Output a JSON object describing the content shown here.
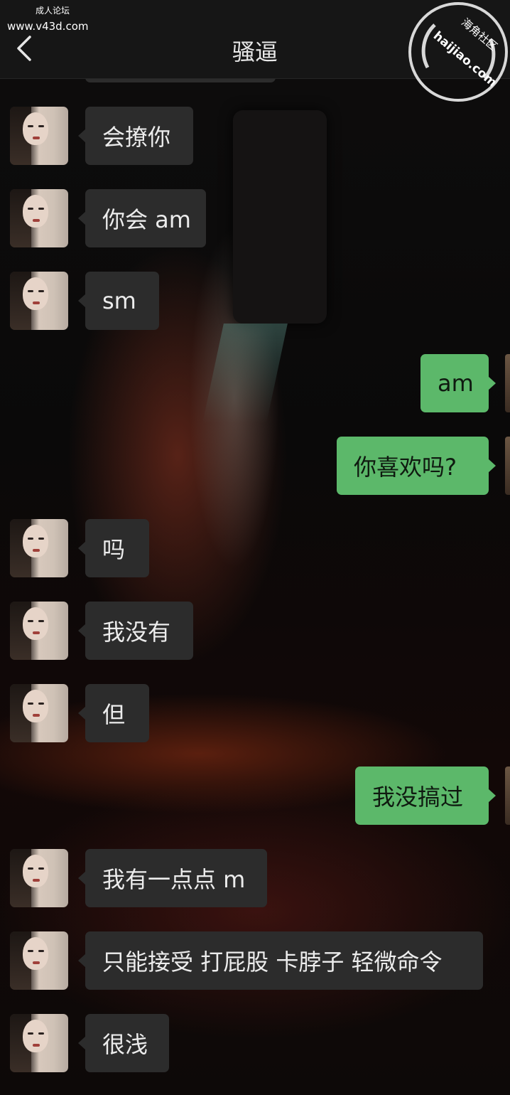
{
  "watermark": {
    "line1": "成人论坛",
    "line2": "www.v43d.com",
    "stamp_top": "海角社区",
    "stamp_bottom": "haijiao.com"
  },
  "header": {
    "title": "骚逼",
    "back_icon": "chevron-left-icon"
  },
  "messages": [
    {
      "side": "in",
      "text": "会撩你"
    },
    {
      "side": "in",
      "text": "你会 am"
    },
    {
      "side": "in",
      "text": "sm"
    },
    {
      "side": "out",
      "text": "am"
    },
    {
      "side": "out",
      "text": "你喜欢吗?"
    },
    {
      "side": "in",
      "text": "吗"
    },
    {
      "side": "in",
      "text": "我没有"
    },
    {
      "side": "in",
      "text": "但"
    },
    {
      "side": "out",
      "text": "我没搞过"
    },
    {
      "side": "in",
      "text": "我有一点点 m"
    },
    {
      "side": "in",
      "text": "只能接受 打屁股 卡脖子 轻微命令"
    },
    {
      "side": "in",
      "text": "很浅"
    }
  ],
  "colors": {
    "incoming_bubble": "#2c2c2c",
    "outgoing_bubble": "#5cb86a",
    "topbar": "#161616"
  }
}
